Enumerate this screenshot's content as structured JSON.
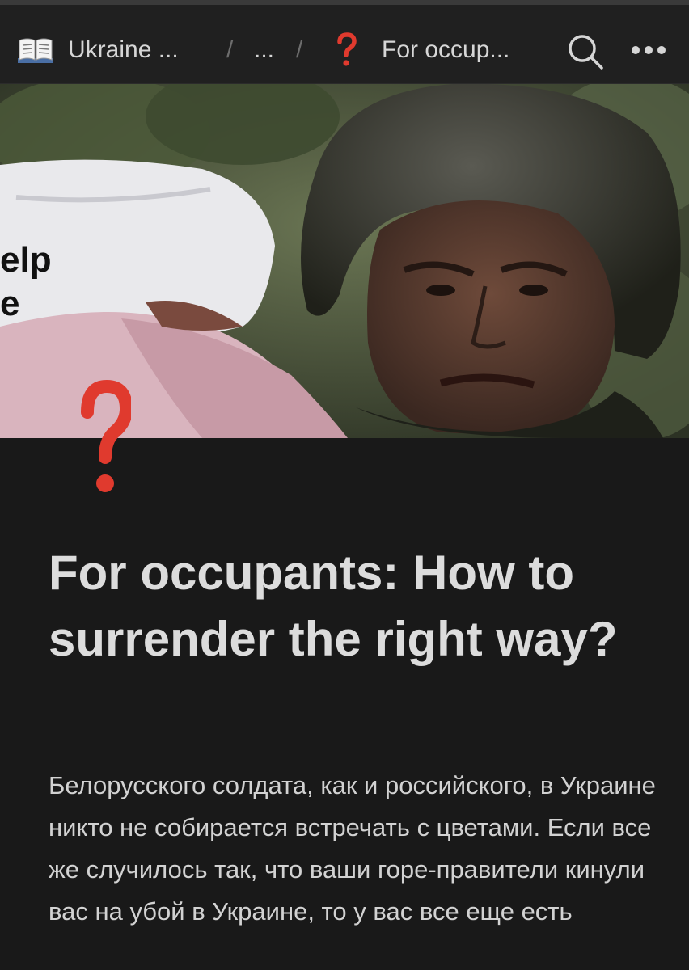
{
  "breadcrumb": {
    "items": [
      {
        "icon": "book-icon",
        "label": "Ukraine ..."
      },
      {
        "label": "..."
      },
      {
        "icon": "question-mark-icon",
        "label": "For occup..."
      }
    ],
    "separator": "/"
  },
  "toolbar": {
    "search_icon": "search-icon",
    "more_icon": "more-horizontal-icon"
  },
  "cover": {
    "visible_text_line1": "elp",
    "visible_text_line2": "e"
  },
  "page": {
    "emoji_icon": "question-mark-icon",
    "title": "For occupants: How to surrender the right way?",
    "body": "Белорусского солдата, как и российского, в Украине никто не собирается встречать с цветами. Если все же случилось так, что ваши горе-правители кинули вас на убой в Украине, то у вас все еще есть"
  },
  "colors": {
    "background": "#191919",
    "topbar": "#202020",
    "text": "#d6d6d6",
    "question_mark": "#e03a2e"
  }
}
